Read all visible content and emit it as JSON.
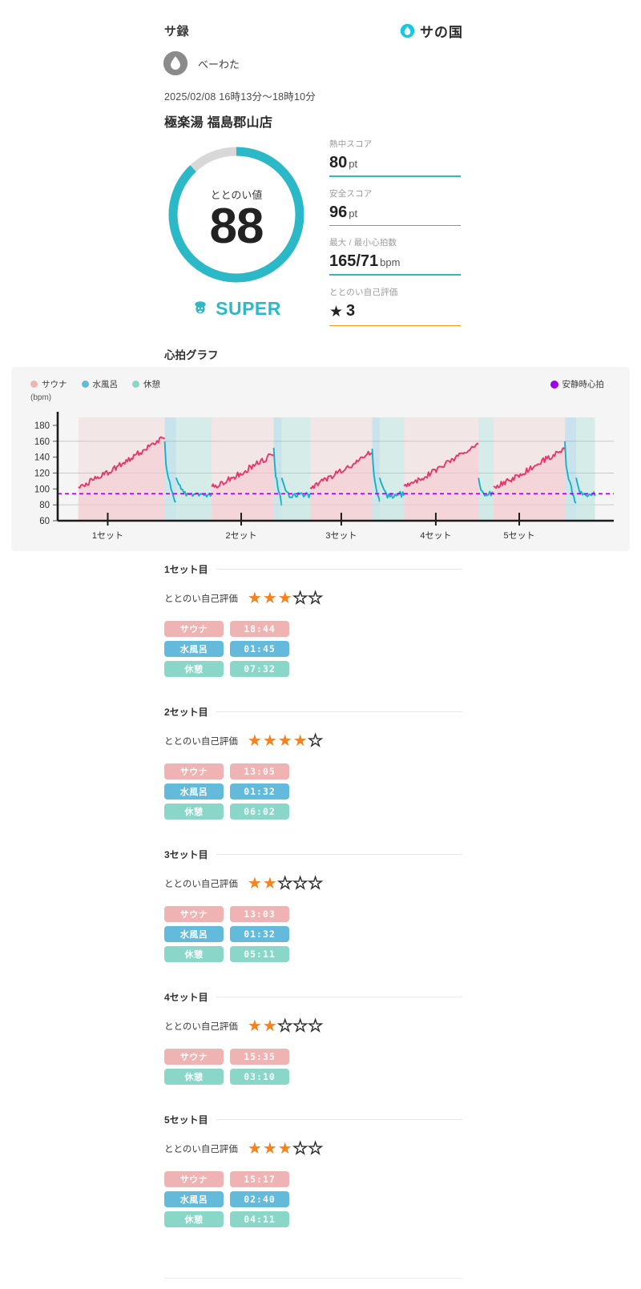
{
  "header": {
    "title": "サ録",
    "brand_text": "サの国",
    "brand_icon": "water-drop-icon"
  },
  "user": {
    "name": "べーわた",
    "avatar_icon": "water-drop-avatar-icon"
  },
  "session": {
    "datetime": "2025/02/08 16時13分〜18時10分",
    "venue": "極楽湯 福島郡山店"
  },
  "score": {
    "label": "ととのい値",
    "value": "88",
    "percent": 88,
    "rank": "SUPER",
    "rank_icon": "sauna-hat-character-icon",
    "ring_color": "#2cb9c7",
    "ring_track_color": "#d8d8d8"
  },
  "metrics": [
    {
      "label": "熱中スコア",
      "value": "80",
      "unit": "pt",
      "line_color": "#2cb9c7"
    },
    {
      "label": "安全スコア",
      "value": "96",
      "unit": "pt",
      "line_color": "#2cb9c7"
    },
    {
      "label": "最大 / 最小心拍数",
      "value": "165/71",
      "unit": "bpm",
      "line_color": "#2cb9c7"
    },
    {
      "label": "ととのい自己評価",
      "value": "3",
      "unit": "",
      "line_color": "#f39c12",
      "star": "★"
    }
  ],
  "chart": {
    "title": "心拍グラフ",
    "legend": [
      {
        "label": "サウナ",
        "color": "#efb3b3"
      },
      {
        "label": "水風呂",
        "color": "#64bada"
      },
      {
        "label": "休憩",
        "color": "#8ad6c9"
      }
    ],
    "legend_right": {
      "label": "安静時心拍",
      "color": "#9b00e8"
    },
    "y_unit": "(bpm)"
  },
  "chart_data": {
    "type": "line",
    "title": "心拍グラフ",
    "xlabel": "",
    "ylabel": "(bpm)",
    "ylim": [
      60,
      185
    ],
    "yticks": [
      60,
      80,
      100,
      120,
      140,
      160,
      180
    ],
    "gridlines": [
      80,
      120,
      160
    ],
    "grid": true,
    "legend_position": "top-left",
    "x_tick_labels": [
      "1セット",
      "2セット",
      "3セット",
      "4セット",
      "5セット"
    ],
    "x_tick_positions_pct": [
      9,
      33,
      51,
      68,
      83
    ],
    "resting_hr": 94,
    "resting_hr_label": "安静時心拍",
    "max_hr": 165,
    "min_hr": 71,
    "phase_colors": {
      "sauna": "#efb3b3",
      "mizuburo": "#64bada",
      "kyukei": "#8ad6c9"
    },
    "series": [
      {
        "name": "心拍数",
        "sauna_color": "#e8366b",
        "cool_color": "#17b0c4"
      }
    ],
    "phases": [
      {
        "set": 1,
        "type": "sauna",
        "start_pct": 5.5,
        "end_pct": 28.5,
        "duration": "18:44",
        "peak": 166
      },
      {
        "set": 1,
        "type": "mizuburo",
        "start_pct": 28.5,
        "end_pct": 31.5,
        "duration": "01:45"
      },
      {
        "set": 1,
        "type": "kyukei",
        "start_pct": 31.5,
        "end_pct": 41.0,
        "duration": "07:32"
      },
      {
        "set": 2,
        "type": "sauna",
        "start_pct": 41.0,
        "end_pct": 57.5,
        "duration": "13:05",
        "peak": 144
      },
      {
        "set": 2,
        "type": "mizuburo",
        "start_pct": 57.5,
        "end_pct": 59.6,
        "duration": "01:32"
      },
      {
        "set": 2,
        "type": "kyukei",
        "start_pct": 59.6,
        "end_pct": 67.2,
        "duration": "06:02"
      },
      {
        "set": 3,
        "type": "sauna",
        "start_pct": 67.2,
        "end_pct": 83.7,
        "duration": "13:03",
        "peak": 147
      },
      {
        "set": 3,
        "type": "mizuburo",
        "start_pct": 83.7,
        "end_pct": 85.7,
        "duration": "01:32"
      },
      {
        "set": 3,
        "type": "kyukei",
        "start_pct": 85.7,
        "end_pct": 92.2,
        "duration": "05:11"
      },
      {
        "set": 4,
        "type": "sauna",
        "start_pct": 92.2,
        "end_pct": 112.0,
        "duration": "15:35",
        "peak": 158
      },
      {
        "set": 4,
        "type": "kyukei",
        "start_pct": 112.0,
        "end_pct": 116.0,
        "duration": "03:10"
      },
      {
        "set": 5,
        "type": "sauna",
        "start_pct": 116.0,
        "end_pct": 135.0,
        "duration": "15:17",
        "peak": 152
      },
      {
        "set": 5,
        "type": "mizuburo",
        "start_pct": 135.0,
        "end_pct": 138.0,
        "duration": "02:40"
      },
      {
        "set": 5,
        "type": "kyukei",
        "start_pct": 138.0,
        "end_pct": 143.0,
        "duration": "04:11"
      }
    ]
  },
  "sets": [
    {
      "title": "1セット目",
      "rating_label": "ととのい自己評価",
      "rating": 3,
      "rating_max": 5,
      "rows": [
        {
          "label": "サウナ",
          "time": "18:44",
          "color": "#efb3b3"
        },
        {
          "label": "水風呂",
          "time": "01:45",
          "color": "#64bada"
        },
        {
          "label": "休憩",
          "time": "07:32",
          "color": "#8ad6c9"
        }
      ]
    },
    {
      "title": "2セット目",
      "rating_label": "ととのい自己評価",
      "rating": 4,
      "rating_max": 5,
      "rows": [
        {
          "label": "サウナ",
          "time": "13:05",
          "color": "#efb3b3"
        },
        {
          "label": "水風呂",
          "time": "01:32",
          "color": "#64bada"
        },
        {
          "label": "休憩",
          "time": "06:02",
          "color": "#8ad6c9"
        }
      ]
    },
    {
      "title": "3セット目",
      "rating_label": "ととのい自己評価",
      "rating": 2,
      "rating_max": 5,
      "rows": [
        {
          "label": "サウナ",
          "time": "13:03",
          "color": "#efb3b3"
        },
        {
          "label": "水風呂",
          "time": "01:32",
          "color": "#64bada"
        },
        {
          "label": "休憩",
          "time": "05:11",
          "color": "#8ad6c9"
        }
      ]
    },
    {
      "title": "4セット目",
      "rating_label": "ととのい自己評価",
      "rating": 2,
      "rating_max": 5,
      "rows": [
        {
          "label": "サウナ",
          "time": "15:35",
          "color": "#efb3b3"
        },
        {
          "label": "休憩",
          "time": "03:10",
          "color": "#8ad6c9"
        }
      ]
    },
    {
      "title": "5セット目",
      "rating_label": "ととのい自己評価",
      "rating": 3,
      "rating_max": 5,
      "rows": [
        {
          "label": "サウナ",
          "time": "15:17",
          "color": "#efb3b3"
        },
        {
          "label": "水風呂",
          "time": "02:40",
          "color": "#64bada"
        },
        {
          "label": "休憩",
          "time": "04:11",
          "color": "#8ad6c9"
        }
      ]
    }
  ]
}
